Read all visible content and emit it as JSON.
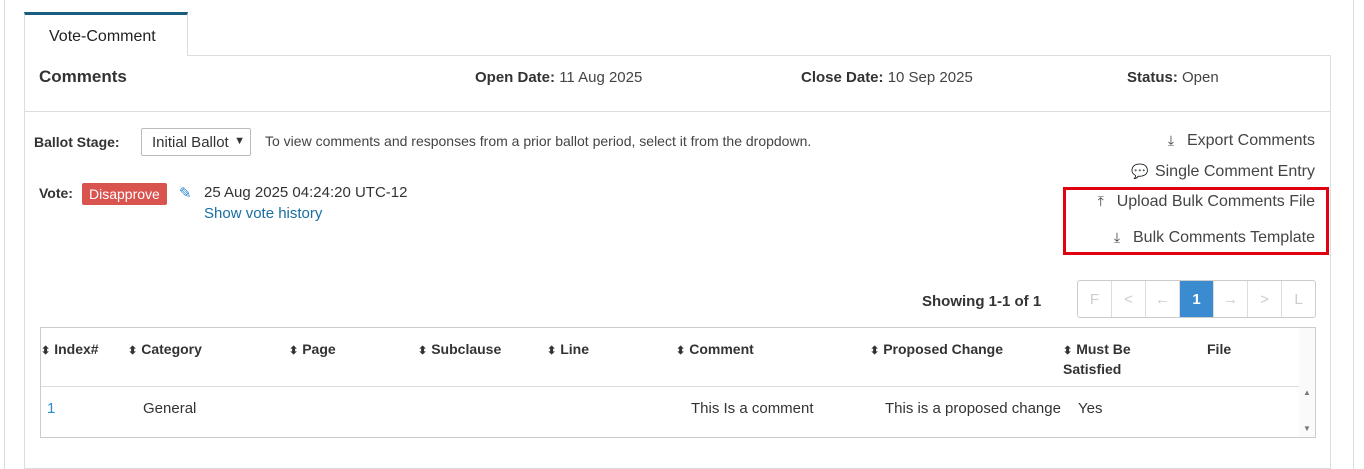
{
  "tab": {
    "label": "Vote-Comment"
  },
  "header": {
    "title": "Comments",
    "open_label": "Open Date:",
    "open_value": "11 Aug 2025",
    "close_label": "Close Date:",
    "close_value": "10 Sep 2025",
    "status_label": "Status:",
    "status_value": "Open"
  },
  "ballot": {
    "label": "Ballot Stage:",
    "selected": "Initial Ballot",
    "hint": "To view comments and responses from a prior ballot period, select it from the dropdown."
  },
  "vote": {
    "label": "Vote:",
    "value": "Disapprove",
    "timestamp": "25 Aug 2025 04:24:20 UTC-12",
    "history_link": "Show vote history"
  },
  "actions": {
    "export": "Export Comments",
    "single": "Single Comment Entry",
    "upload": "Upload Bulk Comments File",
    "template": "Bulk Comments Template"
  },
  "pagination": {
    "showing": "Showing 1-1 of 1",
    "first": "F",
    "prev": "<",
    "prev_arrow": "←",
    "current": "1",
    "next_arrow": "→",
    "next": ">",
    "last": "L"
  },
  "table": {
    "headers": [
      "Index#",
      "Category",
      "Page",
      "Subclause",
      "Line",
      "Comment",
      "Proposed Change",
      "Must Be Satisfied",
      "File"
    ],
    "rows": [
      {
        "index": "1",
        "category": "General",
        "page": "",
        "subclause": "",
        "line": "",
        "comment": "This Is a comment",
        "proposed_change": "This is a proposed change",
        "must_be_satisfied": "Yes",
        "file": ""
      }
    ]
  },
  "colors": {
    "accent": "#1a5d80",
    "disapprove": "#d9534f",
    "link": "#1a6ea1",
    "highlight": "#e0000f",
    "pager_active": "#3b8bd0"
  }
}
